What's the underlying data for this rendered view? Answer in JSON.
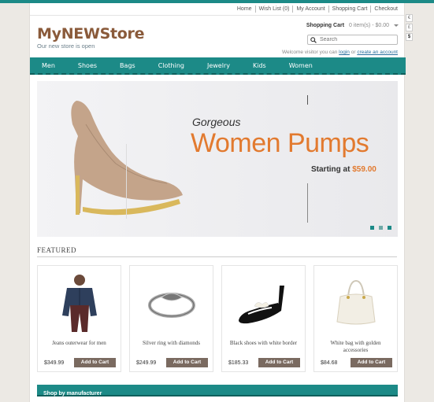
{
  "colors": {
    "accent": "#1c8a87",
    "brand": "#8a5a3a",
    "promo": "#e27a2f",
    "button": "#7a6a60"
  },
  "top_links": [
    "Home",
    "Wish List (0)",
    "My Account",
    "Shopping Cart",
    "Checkout"
  ],
  "logo": "MyNEWStore",
  "tagline": "Our new store is open",
  "cart": {
    "title": "Shopping Cart",
    "count": "0 item(s) - $0.00"
  },
  "search": {
    "placeholder": "Search",
    "icon": "search-icon"
  },
  "welcome": {
    "prefix": "Welcome visitor you can",
    "login": "login",
    "or": "or",
    "create": "create an account"
  },
  "side_tabs": [
    "€",
    "£",
    "$"
  ],
  "nav": [
    "Men",
    "Shoes",
    "Bags",
    "Clothing",
    "Jewelry",
    "Kids",
    "Women"
  ],
  "banner": {
    "kicker": "Gorgeous",
    "title": "Women Pumps",
    "price_prefix": "Starting at",
    "price": "$59.00",
    "slides": 3,
    "active_slide": 2
  },
  "featured": {
    "title": "FEATURED",
    "add_label": "Add to Cart",
    "products": [
      {
        "name": "Jeans outerwear for men",
        "price": "$349.99",
        "icon": "jacket"
      },
      {
        "name": "Silver ring with diamonds",
        "price": "$249.99",
        "icon": "ring"
      },
      {
        "name": "Black shoes with white border",
        "price": "$185.33",
        "icon": "shoe"
      },
      {
        "name": "White bag with golden accessories",
        "price": "$84.68",
        "icon": "bag"
      }
    ]
  },
  "manufacturer": "Shop by manufacturer"
}
